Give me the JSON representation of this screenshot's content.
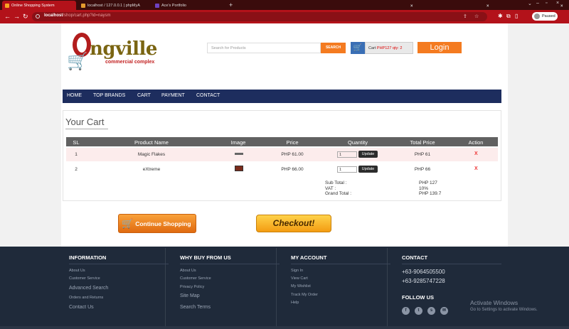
{
  "browser": {
    "tabs": [
      {
        "label": "Online Shopping System",
        "active": true
      },
      {
        "label": "localhost / 127.0.0.1 | phpMyA",
        "active": false
      },
      {
        "label": "Ace's Portfolio",
        "active": false
      }
    ],
    "url_host": "localhost",
    "url_path": "/shop/cart.php?id=naysm",
    "profile_label": "Paused",
    "accent": "#b3121a"
  },
  "header": {
    "logo_text": "ngville",
    "logo_sub": "commercial complex",
    "search_placeholder": "Search for Products",
    "search_button": "SEARCH",
    "cart_label": "Cart",
    "cart_value": "PHP127 qty: 2",
    "login_button": "Login"
  },
  "nav": {
    "items": [
      "HOME",
      "TOP BRANDS",
      "CART",
      "PAYMENT",
      "CONTACT"
    ]
  },
  "cart": {
    "title": "Your Cart",
    "columns": [
      "SL",
      "Product Name",
      "Image",
      "Price",
      "Quantity",
      "Total Price",
      "Action"
    ],
    "rows": [
      {
        "sl": "1",
        "name": "Magic Flakes",
        "price": "PHP 61.00",
        "qty": "1",
        "update": "Update",
        "total": "PHP 61",
        "action": "X"
      },
      {
        "sl": "2",
        "name": "eXtreme",
        "price": "PHP 66.00",
        "qty": "1",
        "update": "Update",
        "total": "PHP 66",
        "action": "X"
      }
    ],
    "subtotal_label": "Sub Total :",
    "vat_label": "VAT :",
    "grand_label": "Grand Total :",
    "subtotal": "PHP 127",
    "vat": "10%",
    "grand": "PHP 139.7",
    "continue_button": "Continue Shopping",
    "checkout_button": "Checkout!"
  },
  "footer": {
    "information": {
      "title": "INFORMATION",
      "links": [
        "About Us",
        "Customer Service",
        "Advanced Search",
        "Orders and Returns",
        "Contact Us"
      ]
    },
    "why": {
      "title": "WHY BUY FROM US",
      "links": [
        "About Us",
        "Customer Service",
        "Privacy Policy",
        "Site Map",
        "Search Terms"
      ]
    },
    "account": {
      "title": "MY ACCOUNT",
      "links": [
        "Sign In",
        "View Cart",
        "My Wishlist",
        "Track My Order",
        "Help"
      ]
    },
    "contact": {
      "title": "CONTACT",
      "phones": [
        "+63-9064505500",
        "+63-9285747228"
      ],
      "follow": "FOLLOW US"
    },
    "watermark_title": "Activate Windows",
    "watermark_sub": "Go to Settings to activate Windows."
  }
}
